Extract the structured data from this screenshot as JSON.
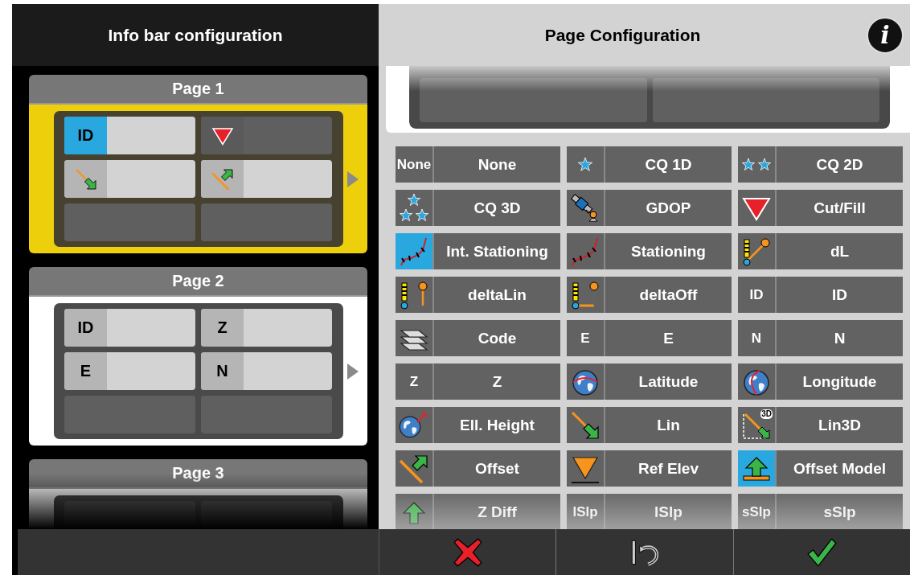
{
  "left_panel": {
    "title": "Info bar configuration",
    "pages": [
      {
        "title": "Page 1",
        "selected": true,
        "slots": [
          {
            "kind": "text",
            "abbr": "ID",
            "active": true,
            "selected": true
          },
          {
            "kind": "cutfill",
            "active": false,
            "selected": false
          },
          {
            "kind": "lin",
            "active": true,
            "selected": false
          },
          {
            "kind": "offset",
            "active": true,
            "selected": false
          },
          {
            "kind": "empty"
          },
          {
            "kind": "empty"
          }
        ]
      },
      {
        "title": "Page 2",
        "selected": false,
        "slots": [
          {
            "kind": "text",
            "abbr": "ID",
            "active": true,
            "selected": false
          },
          {
            "kind": "text",
            "abbr": "Z",
            "active": true,
            "selected": false
          },
          {
            "kind": "text",
            "abbr": "E",
            "active": true,
            "selected": false
          },
          {
            "kind": "text",
            "abbr": "N",
            "active": true,
            "selected": false
          },
          {
            "kind": "empty"
          },
          {
            "kind": "empty"
          }
        ]
      },
      {
        "title": "Page 3",
        "selected": false,
        "slots": [
          {
            "kind": "empty"
          },
          {
            "kind": "empty"
          }
        ]
      }
    ]
  },
  "right_panel": {
    "title": "Page Configuration",
    "info_button": "i",
    "preview": {
      "slots": [
        {
          "kind": "empty"
        },
        {
          "kind": "empty"
        }
      ]
    },
    "options": [
      {
        "kind": "text",
        "abbr": "None",
        "label": "None",
        "selected": false
      },
      {
        "kind": "star1",
        "label": "CQ 1D",
        "selected": false
      },
      {
        "kind": "star2",
        "label": "CQ 2D",
        "selected": false
      },
      {
        "kind": "star3",
        "label": "CQ 3D",
        "selected": false
      },
      {
        "kind": "satellite",
        "label": "GDOP",
        "selected": false
      },
      {
        "kind": "cutfill",
        "label": "Cut/Fill",
        "selected": false
      },
      {
        "kind": "stationing",
        "label": "Int. Stationing",
        "selected": true
      },
      {
        "kind": "stationing",
        "label": "Stationing",
        "selected": false
      },
      {
        "kind": "dl",
        "label": "dL",
        "selected": false
      },
      {
        "kind": "deltalin",
        "label": "deltaLin",
        "selected": false
      },
      {
        "kind": "deltaoff",
        "label": "deltaOff",
        "selected": false
      },
      {
        "kind": "text",
        "abbr": "ID",
        "label": "ID",
        "selected": false
      },
      {
        "kind": "layers",
        "label": "Code",
        "selected": false
      },
      {
        "kind": "text",
        "abbr": "E",
        "label": "E",
        "selected": false
      },
      {
        "kind": "text",
        "abbr": "N",
        "label": "N",
        "selected": false
      },
      {
        "kind": "text",
        "abbr": "Z",
        "label": "Z",
        "selected": false
      },
      {
        "kind": "globe_lat",
        "label": "Latitude",
        "selected": false
      },
      {
        "kind": "globe_lon",
        "label": "Longitude",
        "selected": false
      },
      {
        "kind": "globe_height",
        "label": "Ell. Height",
        "selected": false
      },
      {
        "kind": "lin",
        "label": "Lin",
        "selected": false
      },
      {
        "kind": "lin3d",
        "badge": "3D",
        "label": "Lin3D",
        "selected": false
      },
      {
        "kind": "offset",
        "label": "Offset",
        "selected": false
      },
      {
        "kind": "refelev",
        "label": "Ref Elev",
        "selected": false
      },
      {
        "kind": "offsetmodel",
        "label": "Offset Model",
        "selected": true
      },
      {
        "kind": "zdiff",
        "label": "Z Diff",
        "selected": false
      },
      {
        "kind": "text",
        "abbr": "lSlp",
        "label": "lSlp",
        "selected": false
      },
      {
        "kind": "text",
        "abbr": "sSlp",
        "label": "sSlp",
        "selected": false
      }
    ]
  }
}
